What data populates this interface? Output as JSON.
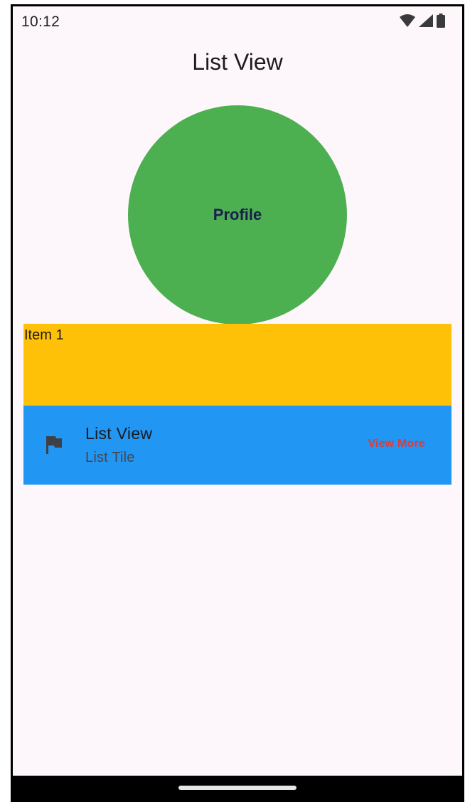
{
  "status_bar": {
    "time": "10:12",
    "icons": [
      "wifi-icon",
      "cellular-signal-icon",
      "battery-icon"
    ]
  },
  "app_bar": {
    "title": "List View"
  },
  "profile": {
    "label": "Profile",
    "color": "#4caf50"
  },
  "item": {
    "label": "Item 1",
    "color": "#ffc107"
  },
  "list_tile": {
    "icon": "flag-icon",
    "title": "List View",
    "subtitle": "List Tile",
    "trailing": "View More",
    "color": "#2196f3",
    "trailing_color": "#e53935"
  }
}
